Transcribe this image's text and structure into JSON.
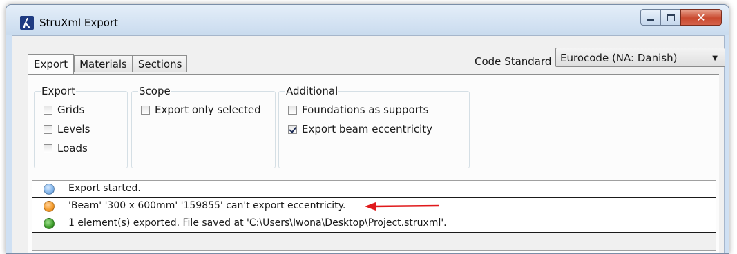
{
  "window": {
    "title": "StruXml Export",
    "app_icon": "autodesk-revit-icon"
  },
  "title_controls": {
    "minimize": "minimize-icon",
    "maximize": "maximize-icon",
    "close": "close-icon"
  },
  "tabs": [
    {
      "label": "Export",
      "active": true
    },
    {
      "label": "Materials",
      "active": false
    },
    {
      "label": "Sections",
      "active": false
    }
  ],
  "code_standard": {
    "label": "Code Standard",
    "value": "Eurocode (NA: Danish)"
  },
  "groups": {
    "export": {
      "legend": "Export",
      "items": [
        {
          "label": "Grids",
          "checked": false
        },
        {
          "label": "Levels",
          "checked": false
        },
        {
          "label": "Loads",
          "checked": false
        }
      ]
    },
    "scope": {
      "legend": "Scope",
      "items": [
        {
          "label": "Export only selected",
          "checked": false
        }
      ]
    },
    "additional": {
      "legend": "Additional",
      "items": [
        {
          "label": "Foundations as supports",
          "checked": false
        },
        {
          "label": "Export beam eccentricity",
          "checked": true
        }
      ]
    }
  },
  "log": [
    {
      "status": "info",
      "color": "#7fb3ea",
      "text": "Export started."
    },
    {
      "status": "warning",
      "color": "#f39a2a",
      "text": "'Beam' '300 x 600mm' '159855' can't export eccentricity."
    },
    {
      "status": "success",
      "color": "#3f9e2c",
      "text": "1 element(s) exported. File saved at 'C:\\Users\\Iwona\\Desktop\\Project.struxml'."
    }
  ],
  "annotation": {
    "arrow_color": "#e0191b"
  }
}
